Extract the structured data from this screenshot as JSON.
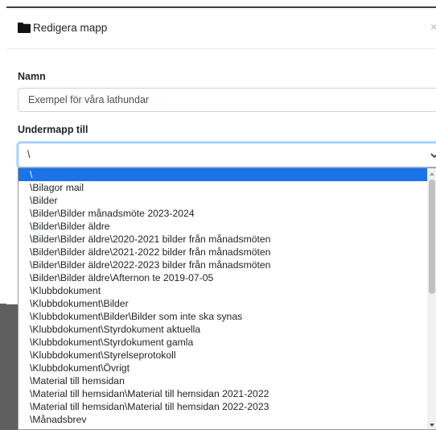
{
  "dialog": {
    "title": "Redigera mapp",
    "close": "×"
  },
  "form": {
    "name_label": "Namn",
    "name_value": "Exempel för våra lathundar",
    "parent_label": "Undermapp till",
    "parent_selected": "\\"
  },
  "dropdown": {
    "options": [
      "\\",
      "\\Bilagor mail",
      "\\Bilder",
      "\\Bilder\\Bilder månadsmöte 2023-2024",
      "\\Bilder\\Bilder äldre",
      "\\Bilder\\Bilder äldre\\2020-2021 bilder från månadsmöten",
      "\\Bilder\\Bilder äldre\\2021-2022 bilder från månadsmöten",
      "\\Bilder\\Bilder äldre\\2022-2023 bilder från månadsmöten",
      "\\Bilder\\Bilder äldre\\Afternon te 2019-07-05",
      "\\Klubbdokument",
      "\\Klubbdokument\\Bilder",
      "\\Klubbdokument\\Bilder\\Bilder som inte ska synas",
      "\\Klubbdokument\\Styrdokument aktuella",
      "\\Klubbdokument\\Styrdokument gamla",
      "\\Klubbdokument\\Styrelseprotokoll",
      "\\Klubbdokument\\Övrigt",
      "\\Material till hemsidan",
      "\\Material till hemsidan\\Material till hemsidan 2021-2022",
      "\\Material till hemsidan\\Material till hemsidan 2022-2023",
      "\\Månadsbrev"
    ],
    "selected_index": 0
  },
  "icons": {
    "title_icon": "folder-icon",
    "select_icon": "chevron-down-icon",
    "scroll_up": "scroll-up-arrow-icon",
    "scroll_down": "scroll-down-arrow-icon"
  },
  "colors": {
    "selection": "#1a73e8",
    "focus_border": "#80bdff"
  }
}
